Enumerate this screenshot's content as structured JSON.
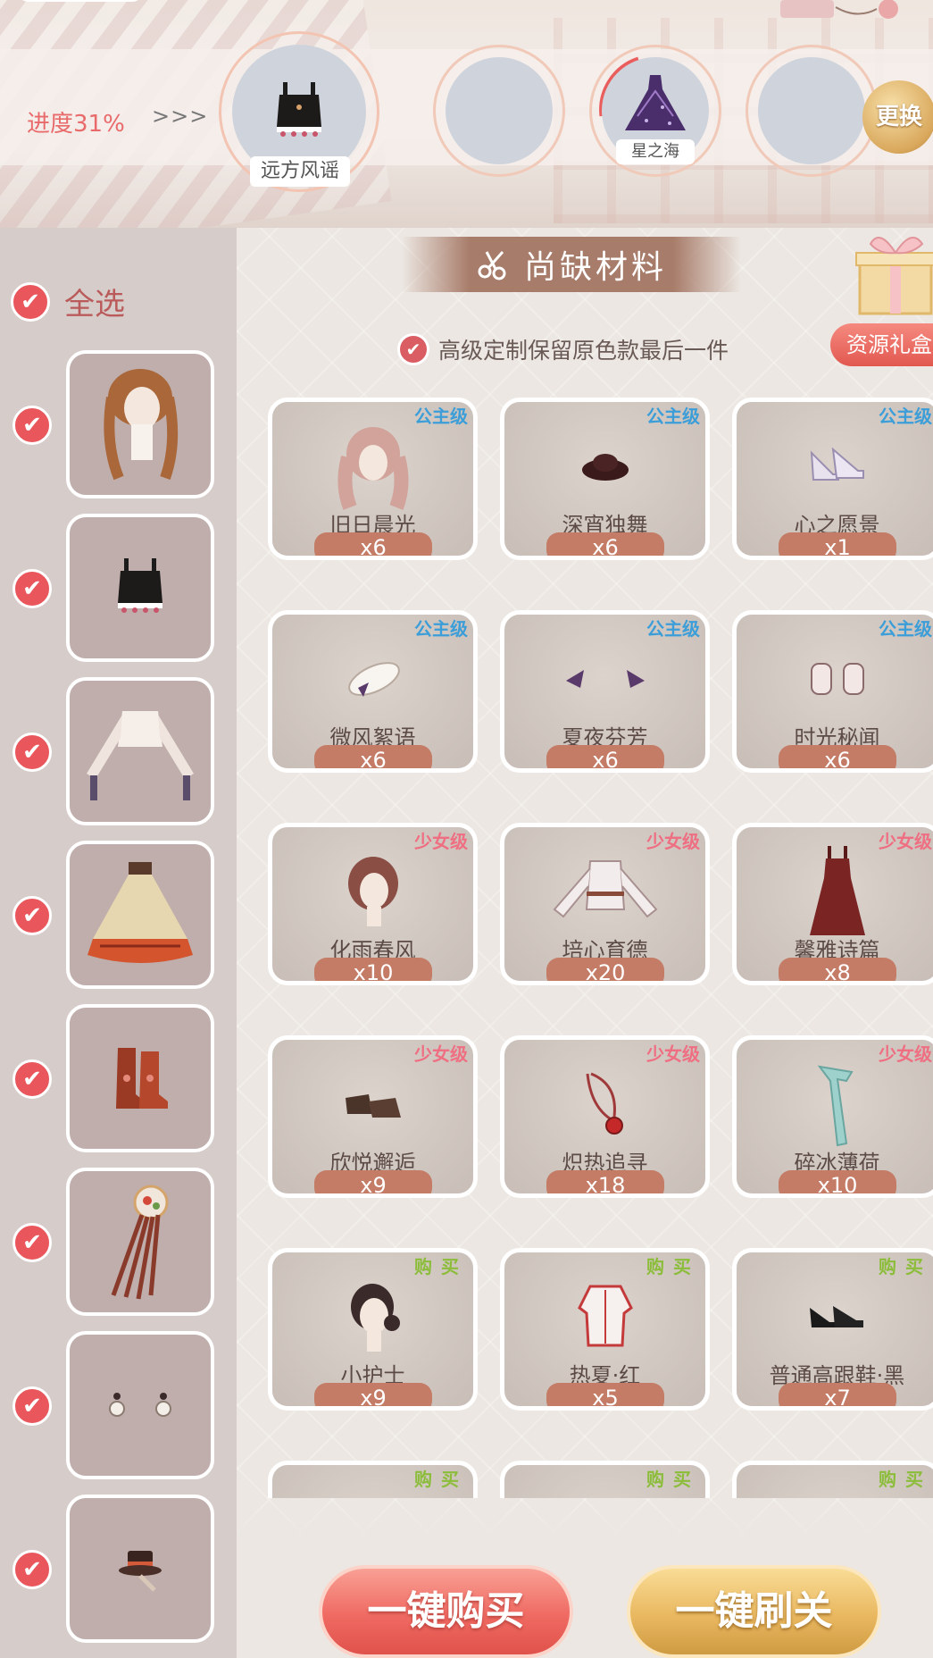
{
  "header": {
    "progress": "进度31%",
    "arrows": ">>>",
    "slots": [
      {
        "label": "远方风谣",
        "filled": true
      },
      {
        "label": "",
        "filled": false
      },
      {
        "label": "星之海",
        "filled": true
      },
      {
        "label": "",
        "filled": false
      }
    ],
    "change_label": "更换"
  },
  "sidebar": {
    "select_all_label": "全选",
    "check_glyph": "✔",
    "items": [
      {
        "kind": "hair"
      },
      {
        "kind": "top"
      },
      {
        "kind": "blouse"
      },
      {
        "kind": "skirt"
      },
      {
        "kind": "boots"
      },
      {
        "kind": "headpiece"
      },
      {
        "kind": "earrings"
      },
      {
        "kind": "hat"
      }
    ]
  },
  "main": {
    "section_title": "尚缺材料",
    "gift_label": "资源礼盒",
    "keep_option_label": "高级定制保留原色款最后一件",
    "cards": [
      {
        "tier": "公主级",
        "tier_type": "princess",
        "name": "旧日晨光",
        "qty": "x6",
        "icon": "wavy-hair"
      },
      {
        "tier": "公主级",
        "tier_type": "princess",
        "name": "深宵独舞",
        "qty": "x6",
        "icon": "dark-hat"
      },
      {
        "tier": "公主级",
        "tier_type": "princess",
        "name": "心之愿景",
        "qty": "x1",
        "icon": "heels"
      },
      {
        "tier": "公主级",
        "tier_type": "princess",
        "name": "微风絮语",
        "qty": "x6",
        "icon": "sun-hat"
      },
      {
        "tier": "公主级",
        "tier_type": "princess",
        "name": "夏夜芬芳",
        "qty": "x6",
        "icon": "earring-pair"
      },
      {
        "tier": "公主级",
        "tier_type": "princess",
        "name": "时光秘闻",
        "qty": "x6",
        "icon": "sleeves"
      },
      {
        "tier": "少女级",
        "tier_type": "girl",
        "name": "化雨春风",
        "qty": "x10",
        "icon": "curly-hair"
      },
      {
        "tier": "少女级",
        "tier_type": "girl",
        "name": "培心育德",
        "qty": "x20",
        "icon": "blouse"
      },
      {
        "tier": "少女级",
        "tier_type": "girl",
        "name": "馨雅诗篇",
        "qty": "x8",
        "icon": "dress"
      },
      {
        "tier": "少女级",
        "tier_type": "girl",
        "name": "欣悦邂逅",
        "qty": "x9",
        "icon": "loafers"
      },
      {
        "tier": "少女级",
        "tier_type": "girl",
        "name": "炽热追寻",
        "qty": "x18",
        "icon": "necklace"
      },
      {
        "tier": "少女级",
        "tier_type": "girl",
        "name": "碎冰薄荷",
        "qty": "x10",
        "icon": "scarf"
      },
      {
        "tier": "购买",
        "tier_type": "buy",
        "name": "小护士",
        "qty": "x9",
        "icon": "bun-hair"
      },
      {
        "tier": "购买",
        "tier_type": "buy",
        "name": "热夏·红",
        "qty": "x5",
        "icon": "jacket"
      },
      {
        "tier": "购买",
        "tier_type": "buy",
        "name": "普通高跟鞋·黑",
        "qty": "x7",
        "icon": "black-heels"
      },
      {
        "tier": "购买",
        "tier_type": "buy",
        "name": "",
        "qty": "",
        "icon": "hat-ring"
      },
      {
        "tier": "购买",
        "tier_type": "buy",
        "name": "",
        "qty": "",
        "icon": "bow"
      },
      {
        "tier": "购买",
        "tier_type": "buy",
        "name": "",
        "qty": "",
        "icon": "card"
      }
    ]
  },
  "footer": {
    "buy_all_label": "一键购买",
    "sweep_label": "一键刷关"
  },
  "colors": {
    "accent_red": "#e9565b",
    "princess_blue": "#3c9ed8",
    "girl_pink": "#ef6f82",
    "buy_green": "#8bbd3a",
    "qty_pill": "#c47c66"
  }
}
